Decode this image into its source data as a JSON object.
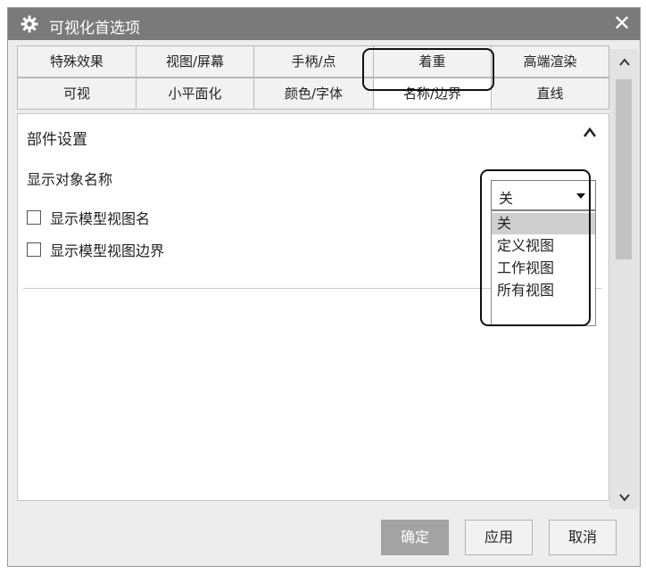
{
  "window": {
    "title": "可视化首选项",
    "title_icon": "gear-icon",
    "close_symbol": "✕",
    "titlebar_color": "#7a7a7a"
  },
  "tabs": {
    "row1": [
      "特殊效果",
      "视图/屏幕",
      "手柄/点",
      "着重",
      "高端渲染"
    ],
    "row2": [
      "可视",
      "小平面化",
      "颜色/字体",
      "名称/边界",
      "直线"
    ],
    "active": "名称/边界"
  },
  "panel": {
    "section_title": "部件设置",
    "collapse_icon": "chevron-up-icon",
    "display_name_label": "显示对象名称",
    "checkboxes": [
      {
        "label": "显示模型视图名",
        "checked": false
      },
      {
        "label": "显示模型视图边界",
        "checked": false
      }
    ]
  },
  "select": {
    "value": "关",
    "caret_icon": "caret-down-icon",
    "options": [
      "关",
      "定义视图",
      "工作视图",
      "所有视图"
    ],
    "highlighted_option": "关"
  },
  "buttons": {
    "ok": "确定",
    "apply": "应用",
    "cancel": "取消"
  }
}
